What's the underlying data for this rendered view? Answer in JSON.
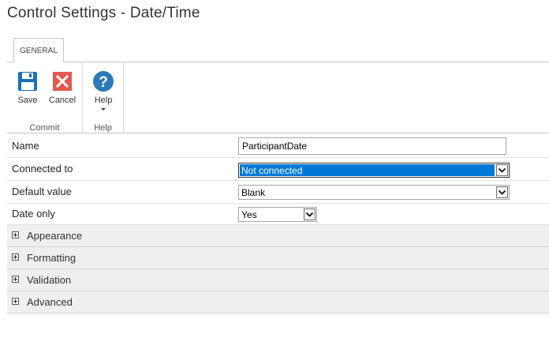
{
  "page": {
    "title": "Control Settings - Date/Time"
  },
  "ribbon": {
    "tab_label": "GENERAL",
    "commit_group_label": "Commit",
    "help_group_label": "Help",
    "save_label": "Save",
    "cancel_label": "Cancel",
    "help_label": "Help"
  },
  "form": {
    "name": {
      "label": "Name",
      "value": "ParticipantDate"
    },
    "connected_to": {
      "label": "Connected to",
      "value": "Not connected"
    },
    "default_value": {
      "label": "Default value",
      "value": "Blank"
    },
    "date_only": {
      "label": "Date only",
      "value": "Yes"
    }
  },
  "sections": {
    "appearance": "Appearance",
    "formatting": "Formatting",
    "validation": "Validation",
    "advanced": "Advanced"
  },
  "colors": {
    "accent": "#0078d7",
    "save_icon": "#1d6fb8",
    "cancel_icon": "#e05a50",
    "help_icon": "#2a7ab9"
  }
}
